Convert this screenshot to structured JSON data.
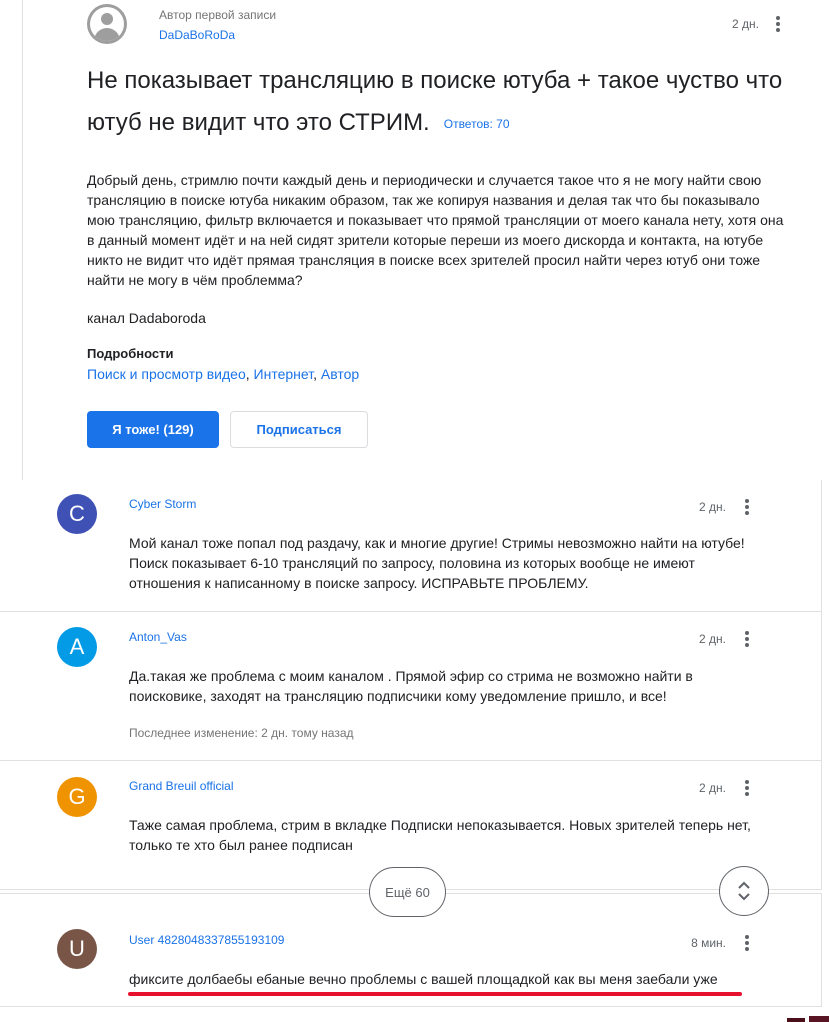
{
  "post": {
    "author_role": "Автор первой записи",
    "author_name": "DaDaBoRoDa",
    "time": "2 дн.",
    "title": "Не показывает трансляцию в поиске ютуба + такое чуство что ютуб не видит что это СТРИМ.",
    "replies_count": "Ответов: 70",
    "body": "Добрый день, стримлю почти каждый день и периодически и случается такое что я не могу найти свою трансляцию в поиске ютуба никаким образом, так же копируя названия и делая так что бы показывало мою трансляцию, фильтр включается и показывает что прямой трансляции от моего канала нету, хотя она в данный момент идёт и на ней сидят зрители которые переши из моего дискорда и контакта, на ютубе никто не видит что идёт прямая трансляция в поиске всех зрителей просил найти через ютуб они тоже найти не могу в чём проблемма?",
    "channel_line": "канал Dadaboroda",
    "details_label": "Подробности",
    "details_links": [
      "Поиск и просмотр видео",
      "Интернет",
      "Автор"
    ],
    "me_too_button": "Я тоже! (129)",
    "subscribe_button": "Подписаться"
  },
  "replies": [
    {
      "initial": "C",
      "avatar_color": "#3f51b5",
      "name": "Cyber Storm",
      "time": "2 дн.",
      "text": "Мой канал тоже попал под раздачу, как и многие другие! Стримы невозможно найти на ютубе! Поиск показывает 6-10 трансляций по запросу, половина из которых вообще не имеют отношения к написанному в поиске запросу. ИСПРАВЬТЕ ПРОБЛЕМУ."
    },
    {
      "initial": "A",
      "avatar_color": "#039be5",
      "name": "Anton_Vas",
      "time": "2 дн.",
      "text": "Да.такая же проблема с моим каналом . Прямой эфир со стрима не возможно найти в поисковике, заходят на трансляцию подписчики кому уведомление пришло, и все!",
      "edited": "Последнее изменение: 2 дн. тому назад"
    },
    {
      "initial": "G",
      "avatar_color": "#f09300",
      "name": "Grand Breuil official",
      "time": "2 дн.",
      "text": "Таже самая проблема, стрим в вкладке Подписки непоказывается. Новых зрителей теперь нет, только те хто был ранее подписан"
    },
    {
      "initial": "U",
      "avatar_color": "#795548",
      "name": "User 4828048337855193109",
      "time": "8 мин.",
      "text": "фиксите долбаебы ебаные вечно проблемы с вашей площадкой как вы меня заебали уже"
    }
  ],
  "more_replies_label": "Ещё 60",
  "colors": {
    "accent": "#1a73e8",
    "highlight_underline": "#e8112d"
  },
  "icons": {
    "menu": "more-vert-icon",
    "expand": "unfold-more-icon",
    "author_avatar": "account-circle-icon"
  }
}
